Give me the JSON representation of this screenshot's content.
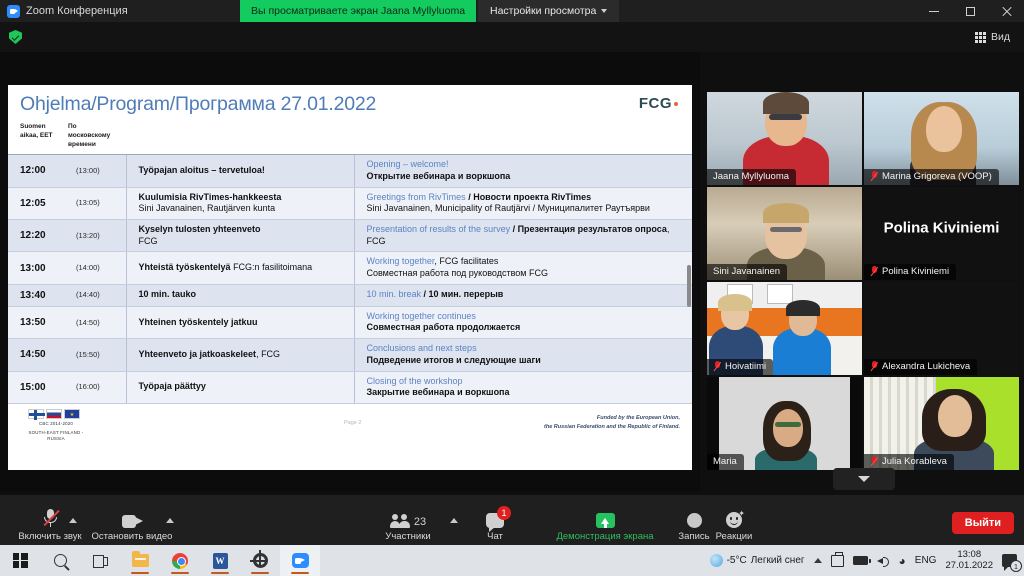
{
  "window": {
    "app_title": "Zoom Конференция",
    "share_banner": "Вы просматриваете экран Jaana Myllyluoma",
    "share_options": "Настройки просмотра",
    "view_button": "Вид"
  },
  "slide": {
    "title": "Ohjelma/Program/Программа 27.01.2022",
    "logo": "FCG",
    "columns": [
      "Suomen aikaa, EET",
      "По московскому времени",
      "",
      ""
    ],
    "rows": [
      {
        "time_fi": "12:00",
        "time_msk": "(13:00)",
        "fi_title": "Työpajan aloitus – tervetuloa!",
        "fi_sub": "",
        "en": "Opening – welcome!",
        "ru": "Открытие вебинара и воркшопа",
        "ru_tail": ""
      },
      {
        "time_fi": "12:05",
        "time_msk": "(13:05)",
        "fi_title": "Kuulumisia RivTimes-hankkeesta",
        "fi_sub": "Sini Javanainen, Rautjärven kunta",
        "en": "Greetings from RivTimes",
        "ru": " / Новости проекта RivTimes",
        "ru_tail": "Sini Javanainen, Municipality of Rautjärvi / Муниципалитет Раутъярви"
      },
      {
        "time_fi": "12:20",
        "time_msk": "(13:20)",
        "fi_title": "Kyselyn tulosten yhteenveto",
        "fi_sub": "FCG",
        "en": "Presentation of results of  the survey",
        "ru": " / Презентация результатов опроса",
        "ru_tail": ", FCG"
      },
      {
        "time_fi": "13:00",
        "time_msk": "(14:00)",
        "fi_title": "Yhteistä työskentelyä",
        "fi_sub": "FCG:n fasilitoimana",
        "en": "Working together",
        "ru": ", FCG facilitates",
        "ru_tail": "Совместная работа под руководством FCG"
      },
      {
        "time_fi": "13:40",
        "time_msk": "(14:40)",
        "fi_title": "10 min. tauko",
        "fi_sub": "",
        "en": "10 min. break",
        "ru": " / 10 мин. перерыв",
        "ru_tail": ""
      },
      {
        "time_fi": "13:50",
        "time_msk": "(14:50)",
        "fi_title": "Yhteinen työskentely jatkuu",
        "fi_sub": "",
        "en": "Working together continues",
        "ru": "Совместная работа продолжается",
        "ru_tail": ""
      },
      {
        "time_fi": "14:50",
        "time_msk": "(15:50)",
        "fi_title": "Yhteenveto ja jatkoaskeleet",
        "fi_sub": ", FCG",
        "en": "Conclusions and next steps",
        "ru": "Подведение итогов и следующие шаги",
        "ru_tail": ""
      },
      {
        "time_fi": "15:00",
        "time_msk": "(16:00)",
        "fi_title": "Työpaja päättyy",
        "fi_sub": "",
        "en": "Closing of the workshop",
        "ru": "Закрытие вебинара и воркшопа",
        "ru_tail": ""
      }
    ],
    "footer": {
      "programme": "CBC 2014-2020",
      "programme_sub": "SOUTH-EAST FINLAND - RUSSIA",
      "page": "Page 2",
      "funding_line1": "Funded by the European Union,",
      "funding_line2": "the Russian Federation and the Republic of Finland."
    }
  },
  "participants": [
    {
      "name": "Jaana Myllyluoma",
      "muted": false,
      "speaking": false,
      "video": true
    },
    {
      "name": "Marina Grigoreva (VOOP)",
      "muted": true,
      "speaking": false,
      "video": true
    },
    {
      "name": "Sini Javanainen",
      "muted": false,
      "speaking": true,
      "video": true
    },
    {
      "name": "Polina Kiviniemi",
      "muted": true,
      "speaking": false,
      "video": false,
      "initials_label": "Polina Kiviniemi"
    },
    {
      "name": "Hoivatiimi",
      "muted": true,
      "speaking": false,
      "video": true
    },
    {
      "name": "Alexandra Lukicheva",
      "muted": true,
      "speaking": false,
      "video": false
    },
    {
      "name": "Maria",
      "muted": false,
      "speaking": false,
      "video": true
    },
    {
      "name": "Julia Korableva",
      "muted": true,
      "speaking": false,
      "video": true
    }
  ],
  "toolbar": {
    "audio_label": "Включить звук",
    "video_label": "Остановить видео",
    "participants_label": "Участники",
    "participants_count": "23",
    "chat_label": "Чат",
    "chat_badge": "1",
    "share_label": "Демонстрация экрана",
    "record_label": "Запись",
    "reactions_label": "Реакции",
    "leave_label": "Выйти"
  },
  "taskbar": {
    "weather_temp": "-5°C",
    "weather_desc": "Легкий снег",
    "language": "ENG",
    "time": "13:08",
    "date": "27.01.2022",
    "notification_count": "1",
    "word_glyph": "W"
  }
}
